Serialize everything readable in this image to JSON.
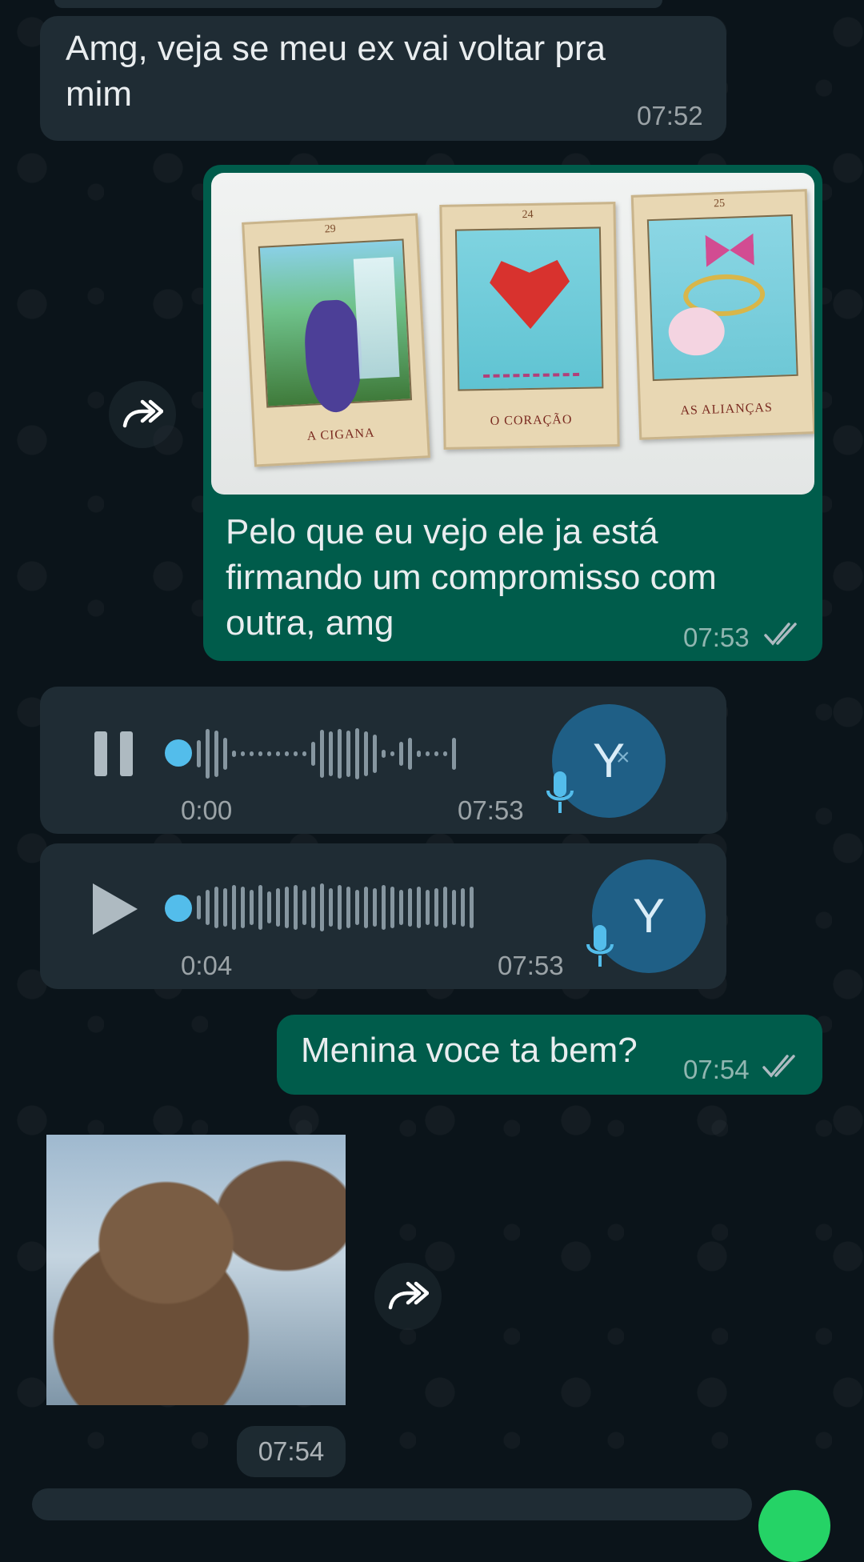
{
  "messages": {
    "msg1": {
      "text": "Amg, veja se meu ex vai voltar pra mim",
      "time": "07:52"
    },
    "msg2": {
      "cards": [
        {
          "number": "29",
          "caption": "A CIGANA"
        },
        {
          "number": "24",
          "caption": "O CORAÇÃO"
        },
        {
          "number": "25",
          "caption": "AS ALIANÇAS"
        }
      ],
      "text": "Pelo que eu vejo ele ja está firmando um compromisso com outra, amg",
      "time": "07:53"
    },
    "voice1": {
      "elapsed": "0:00",
      "time": "07:53",
      "avatar_letter": "Y",
      "state": "playing"
    },
    "voice2": {
      "elapsed": "0:04",
      "time": "07:53",
      "avatar_letter": "Y",
      "state": "paused"
    },
    "msg3": {
      "text": "Menina voce ta bem?",
      "time": "07:54"
    },
    "sticker": {
      "time": "07:54"
    }
  },
  "colors": {
    "background": "#0b141a",
    "incoming_bubble": "#1f2c34",
    "outgoing_bubble": "#005c4b",
    "voice_dot": "#53bdeb",
    "avatar": "#1f5f86",
    "read_ticks": "#aebac1"
  },
  "icons": [
    "forward-icon",
    "pause-icon",
    "play-icon",
    "mic-icon",
    "double-check-icon"
  ]
}
